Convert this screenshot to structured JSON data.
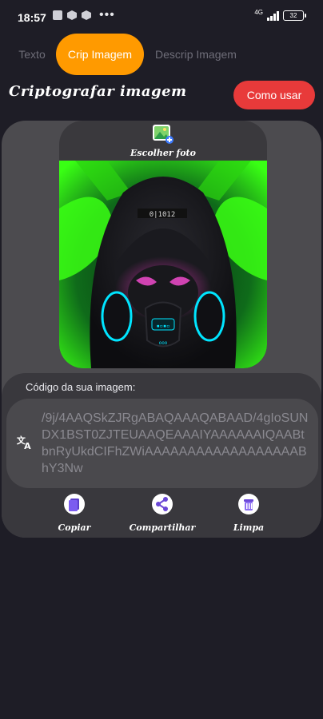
{
  "status": {
    "time": "18:57",
    "network_label": "4G",
    "battery": "32",
    "more": "•••"
  },
  "tabs": [
    {
      "label": "Texto"
    },
    {
      "label": "Crip Imagem",
      "active": true
    },
    {
      "label": "Descrip Imagem"
    }
  ],
  "header": {
    "title": "Criptografar imagem",
    "help_button": "Como usar"
  },
  "photo": {
    "choose_label": "Escolher foto",
    "poster_text": "0|1012"
  },
  "code": {
    "label": "Código da sua imagem:",
    "value": "/9j/4AAQSkZJRgABAQAAAQABAAD/4gIoSUNDX1BST0ZJTEUAAQEAAAIYAAAAAAIQAABtbnRyUkdCIFhZWiAAAAAAAAAAAAAAAAAABhY3Nw"
  },
  "actions": [
    {
      "label": "Copiar",
      "icon": "copy-icon"
    },
    {
      "label": "Compartilhar",
      "icon": "share-icon"
    },
    {
      "label": "Limpa",
      "icon": "clear-icon"
    }
  ],
  "colors": {
    "background": "#1e1d26",
    "active_tab": "#ff9a00",
    "help_button": "#e83a3a",
    "card": "#4c4b4f",
    "neon_green": "#39ff14",
    "neon_cyan": "#00e5ff"
  }
}
